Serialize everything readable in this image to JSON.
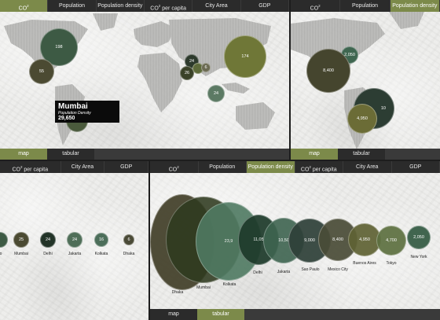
{
  "top_left": {
    "tabs": [
      {
        "main": "CO",
        "sup": "2",
        "active": true
      },
      {
        "main": "Population",
        "sup": "",
        "active": false
      },
      {
        "main": "Population density",
        "sup": "",
        "active": false
      },
      {
        "main": "CO",
        "sup": "2",
        "suffix": " per capita",
        "active": false
      },
      {
        "main": "City Area",
        "sup": "",
        "active": false
      },
      {
        "main": "GDP",
        "sup": "",
        "active": false
      }
    ],
    "bubbles": [
      {
        "value": "198",
        "color": "#3d5a44"
      },
      {
        "value": "55",
        "color": "#4b4a32"
      },
      {
        "value": "24",
        "color": "#2d3a2c"
      },
      {
        "value": "26",
        "color": "#3a4228"
      },
      {
        "value": "",
        "color": "#5d6a3a"
      },
      {
        "value": "6",
        "color": "#6b6a52"
      },
      {
        "value": "174",
        "color": "#6f7737"
      },
      {
        "value": "24",
        "color": "#5c7a64"
      },
      {
        "value": "",
        "color": "#4a5a3c"
      }
    ],
    "tooltip": {
      "city": "Mumbai",
      "metric": "Population Density",
      "value": "29,650"
    },
    "footer": {
      "map": "map",
      "tabular": "tabular",
      "active": "map"
    }
  },
  "top_right": {
    "tabs": [
      {
        "main": "CO",
        "sup": "2",
        "active": false
      },
      {
        "main": "Population",
        "sup": "",
        "active": false
      },
      {
        "main": "Population density",
        "sup": "",
        "active": true
      }
    ],
    "bubbles": [
      {
        "value": "2,050",
        "color": "#3f6650"
      },
      {
        "value": "8,400",
        "color": "#45452e"
      },
      {
        "value": "10",
        "color": "#2c3d33"
      },
      {
        "value": "4,950",
        "color": "#6b6c36"
      }
    ],
    "footer": {
      "map": "map",
      "tabular": "tabular",
      "active": "map"
    }
  },
  "bottom_left": {
    "tabs": [
      {
        "main": "CO",
        "sup": "2",
        "suffix": " per capita",
        "active": false
      },
      {
        "main": "City Area",
        "sup": "",
        "active": false
      },
      {
        "main": "GDP",
        "sup": "",
        "active": false
      }
    ],
    "bubbles": [
      {
        "value": "",
        "label": "o",
        "color": "#3d5a44"
      },
      {
        "value": "25",
        "label": "Mumbai",
        "color": "#4b4a32"
      },
      {
        "value": "24",
        "label": "Delhi",
        "color": "#233428"
      },
      {
        "value": "24",
        "label": "Jakarta",
        "color": "#4f6e58"
      },
      {
        "value": "16",
        "label": "Kolkata",
        "color": "#4c6e5a"
      },
      {
        "value": "6",
        "label": "Dhaka",
        "color": "#4a4a36"
      }
    ]
  },
  "bottom_right": {
    "tabs": [
      {
        "main": "CO",
        "sup": "2",
        "active": false
      },
      {
        "main": "Population",
        "sup": "",
        "active": false
      },
      {
        "main": "Population density",
        "sup": "",
        "active": true
      },
      {
        "main": "CO",
        "sup": "2",
        "suffix": " per capita",
        "active": false
      },
      {
        "main": "City Area",
        "sup": "",
        "active": false
      },
      {
        "main": "GDP",
        "sup": "",
        "active": false
      }
    ],
    "bubbles": [
      {
        "value": "",
        "label": "Dhaka",
        "color": "#3e3b24"
      },
      {
        "value": "",
        "label": "Mumbai",
        "color": "#2f3a1f"
      },
      {
        "value": "23,9",
        "label": "Kolkata",
        "color": "#4f7a62"
      },
      {
        "value": "11,05",
        "label": "Delhi",
        "color": "#1d3a2a"
      },
      {
        "value": "10,50",
        "label": "Jakarta",
        "color": "#3e6450"
      },
      {
        "value": "9,000",
        "label": "Sao Paulo",
        "color": "#2e4038"
      },
      {
        "value": "8,400",
        "label": "Mexico City",
        "color": "#4a4c37"
      },
      {
        "value": "4,950",
        "label": "Buenos Aires",
        "color": "#5f6234"
      },
      {
        "value": "4,700",
        "label": "Tokyo",
        "color": "#5d7040"
      },
      {
        "value": "2,050",
        "label": "New York",
        "color": "#41654f"
      }
    ],
    "footer": {
      "map": "map",
      "tabular": "tabular",
      "active": "tabular"
    }
  }
}
